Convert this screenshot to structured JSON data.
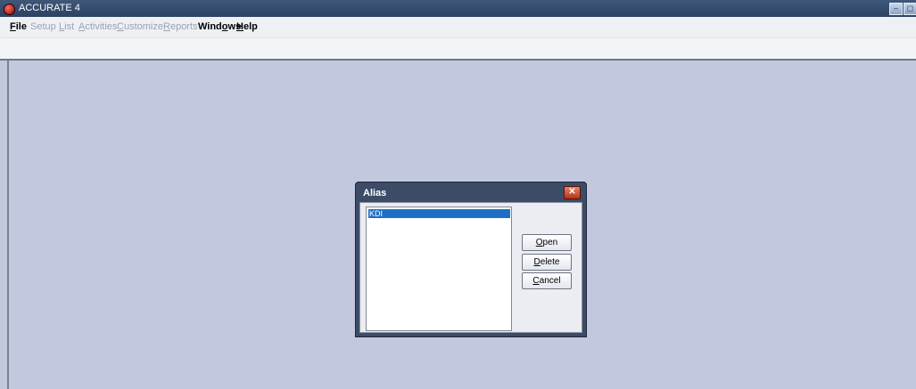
{
  "window": {
    "title": "ACCURATE 4",
    "minimize_symbol": "–",
    "restore_symbol": "◻",
    "app_icon": "red-circle-icon"
  },
  "menu": {
    "items": [
      {
        "label": "File",
        "mnemonic": "F",
        "rest": "ile",
        "enabled": true
      },
      {
        "label": "Setup",
        "mnemonic": "",
        "rest": "Setup",
        "enabled": false
      },
      {
        "label": "List",
        "mnemonic": "L",
        "rest": "ist",
        "enabled": false
      },
      {
        "label": "Activities",
        "mnemonic": "A",
        "rest": "ctivities",
        "enabled": false
      },
      {
        "label": "Customize",
        "mnemonic": "C",
        "rest": "ustomize",
        "enabled": false
      },
      {
        "label": "Reports",
        "mnemonic": "R",
        "rest": "eports",
        "enabled": false
      },
      {
        "label": "Windows",
        "pre": "Wind",
        "mnemonic": "o",
        "rest": "ws",
        "enabled": true
      },
      {
        "label": "Help",
        "mnemonic": "H",
        "rest": "elp",
        "enabled": true
      }
    ]
  },
  "dialog": {
    "title": "Alias",
    "close_symbol": "✕",
    "list_items": [
      "KDI"
    ],
    "buttons": {
      "open": {
        "mnemonic": "O",
        "rest": "pen"
      },
      "delete": {
        "mnemonic": "D",
        "rest": "elete"
      },
      "cancel": {
        "mnemonic": "C",
        "rest": "ancel"
      }
    }
  },
  "colors": {
    "title_bar": "#2f4666",
    "workspace": "#c2c9df",
    "selection": "#1f6fc7"
  }
}
